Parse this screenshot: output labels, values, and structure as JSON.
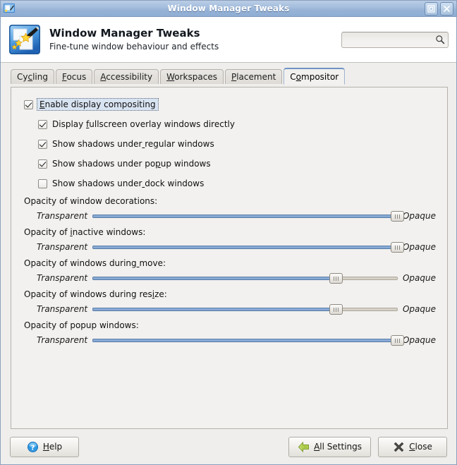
{
  "window": {
    "title": "Window Manager Tweaks",
    "icon": "wm-tweaks-icon",
    "buttons": [
      {
        "name": "maximize-button",
        "glyph": "maximize-icon"
      },
      {
        "name": "close-button",
        "glyph": "close-icon"
      }
    ]
  },
  "header": {
    "icon": "wm-tweaks-large-icon",
    "title": "Window Manager Tweaks",
    "subtitle": "Fine-tune window behaviour and effects",
    "search": {
      "value": "",
      "placeholder": "",
      "icon": "search-icon"
    }
  },
  "tabs": [
    {
      "label": "Cycling",
      "mnemonic_index": 2,
      "active": false
    },
    {
      "label": "Focus",
      "mnemonic_index": 0,
      "active": false
    },
    {
      "label": "Accessibility",
      "mnemonic_index": 0,
      "active": false
    },
    {
      "label": "Workspaces",
      "mnemonic_index": 0,
      "active": false
    },
    {
      "label": "Placement",
      "mnemonic_index": 0,
      "active": false
    },
    {
      "label": "Compositor",
      "mnemonic_index": 1,
      "active": true
    }
  ],
  "checkboxes": [
    {
      "label": "Enable display compositing",
      "mnemonic_index": 0,
      "checked": true,
      "indent": false,
      "focused": true
    },
    {
      "label": "Display fullscreen overlay windows directly",
      "mnemonic_index": 8,
      "checked": true,
      "indent": true,
      "focused": false
    },
    {
      "label": "Show shadows under regular windows",
      "mnemonic_index": 18,
      "checked": true,
      "indent": true,
      "focused": false
    },
    {
      "label": "Show shadows under popup windows",
      "mnemonic_index": 21,
      "checked": true,
      "indent": true,
      "focused": false
    },
    {
      "label": "Show shadows under dock windows",
      "mnemonic_index": 18,
      "checked": false,
      "indent": true,
      "focused": false
    }
  ],
  "sliders": [
    {
      "caption": "Opacity of window decorations:",
      "mnemonic_index": -1,
      "min_label": "Transparent",
      "max_label": "Opaque",
      "value": 100
    },
    {
      "caption": "Opacity of inactive windows:",
      "mnemonic_index": 11,
      "min_label": "Transparent",
      "max_label": "Opaque",
      "value": 100
    },
    {
      "caption": "Opacity of windows during move:",
      "mnemonic_index": 25,
      "min_label": "Transparent",
      "max_label": "Opaque",
      "value": 80
    },
    {
      "caption": "Opacity of windows during resize:",
      "mnemonic_index": 29,
      "min_label": "Transparent",
      "max_label": "Opaque",
      "value": 80
    },
    {
      "caption": "Opacity of popup windows:",
      "mnemonic_index": -1,
      "min_label": "Transparent",
      "max_label": "Opaque",
      "value": 100
    }
  ],
  "buttons": {
    "help": {
      "label": "Help",
      "mnemonic_index": 0,
      "icon": "help-icon"
    },
    "all_settings": {
      "label": "All Settings",
      "mnemonic_index": 0,
      "icon": "back-arrow-icon"
    },
    "close": {
      "label": "Close",
      "mnemonic_index": 0,
      "icon": "close-x-icon"
    }
  },
  "colors": {
    "titlebar": "#a5bedd",
    "slider_fill": "#7da2ce",
    "slider_groove": "#cdc8bc",
    "panel_bg": "#f2f1ef",
    "focus_highlight": "#d9e4f2",
    "help_icon": "#2a8fdd",
    "arrow_icon": "#9fc24a",
    "close_icon": "#4a4a48"
  }
}
